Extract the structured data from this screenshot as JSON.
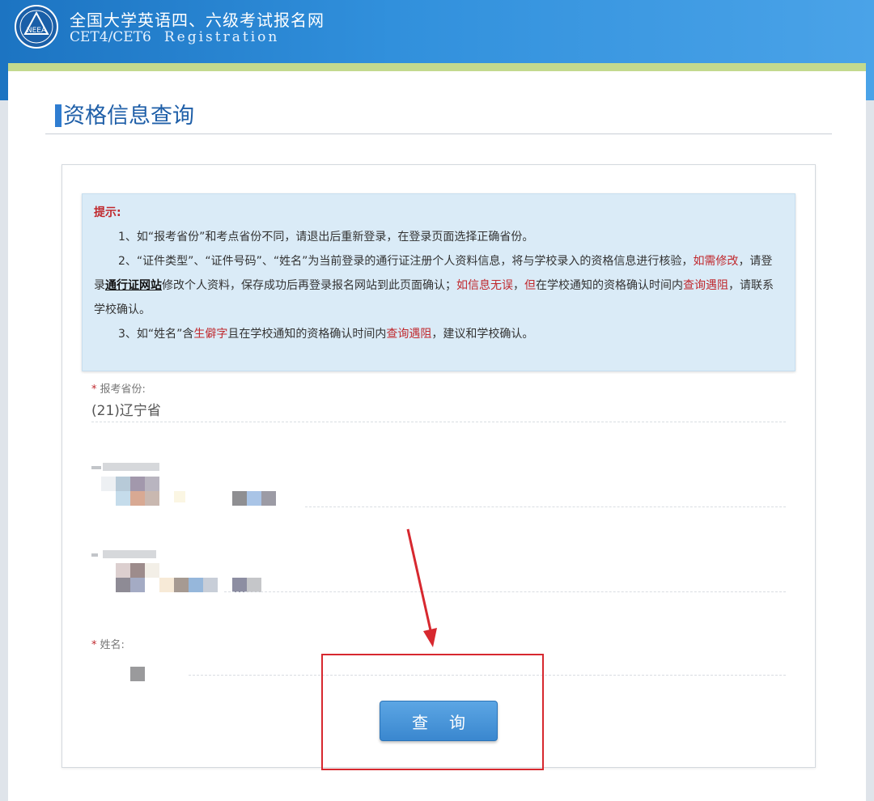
{
  "header": {
    "title": "全国大学英语四、六级考试报名网",
    "subtitle_code": "CET4/CET6",
    "subtitle_word": "Registration",
    "logo_text": "NEEA",
    "bg_color": "#2f8bd8"
  },
  "section": {
    "title": "资格信息查询"
  },
  "notice": {
    "heading": "提示:",
    "item1": "1、如“报考省份”和考点省份不同，请退出后重新登录，在登录页面选择正确省份。",
    "item2": {
      "part1": "2、“证件类型”、“证件号码”、“姓名”为当前登录的通行证注册个人资料信息，将与学校录入的资格信息进行核验，",
      "red1": "如需修改",
      "part2": "，请登录",
      "link": "通行证网站",
      "part3": "修改个人资料，保存成功后再登录报名网站到此页面确认；",
      "red2": "如信息无误",
      "part4": "，",
      "red3": "但",
      "part5": "在学校通知的资格确认时间内",
      "red4": "查询遇阻",
      "part6": "，请联系学校确认。"
    },
    "item3": {
      "part1": "3、如“姓名”含",
      "red1": "生僻字",
      "part2": "且在学校通知的资格确认时间内",
      "red2": "查询遇阻",
      "part3": "，建议和学校确认。"
    }
  },
  "fields": {
    "province_label": "报考省份:",
    "province_value": "(21)辽宁省",
    "name_label": "姓名:"
  },
  "query_button": {
    "label": "查询"
  },
  "colors": {
    "accent": "#2f7dd1",
    "warning_red": "#c0282d",
    "annotation_red": "#d7282f"
  }
}
